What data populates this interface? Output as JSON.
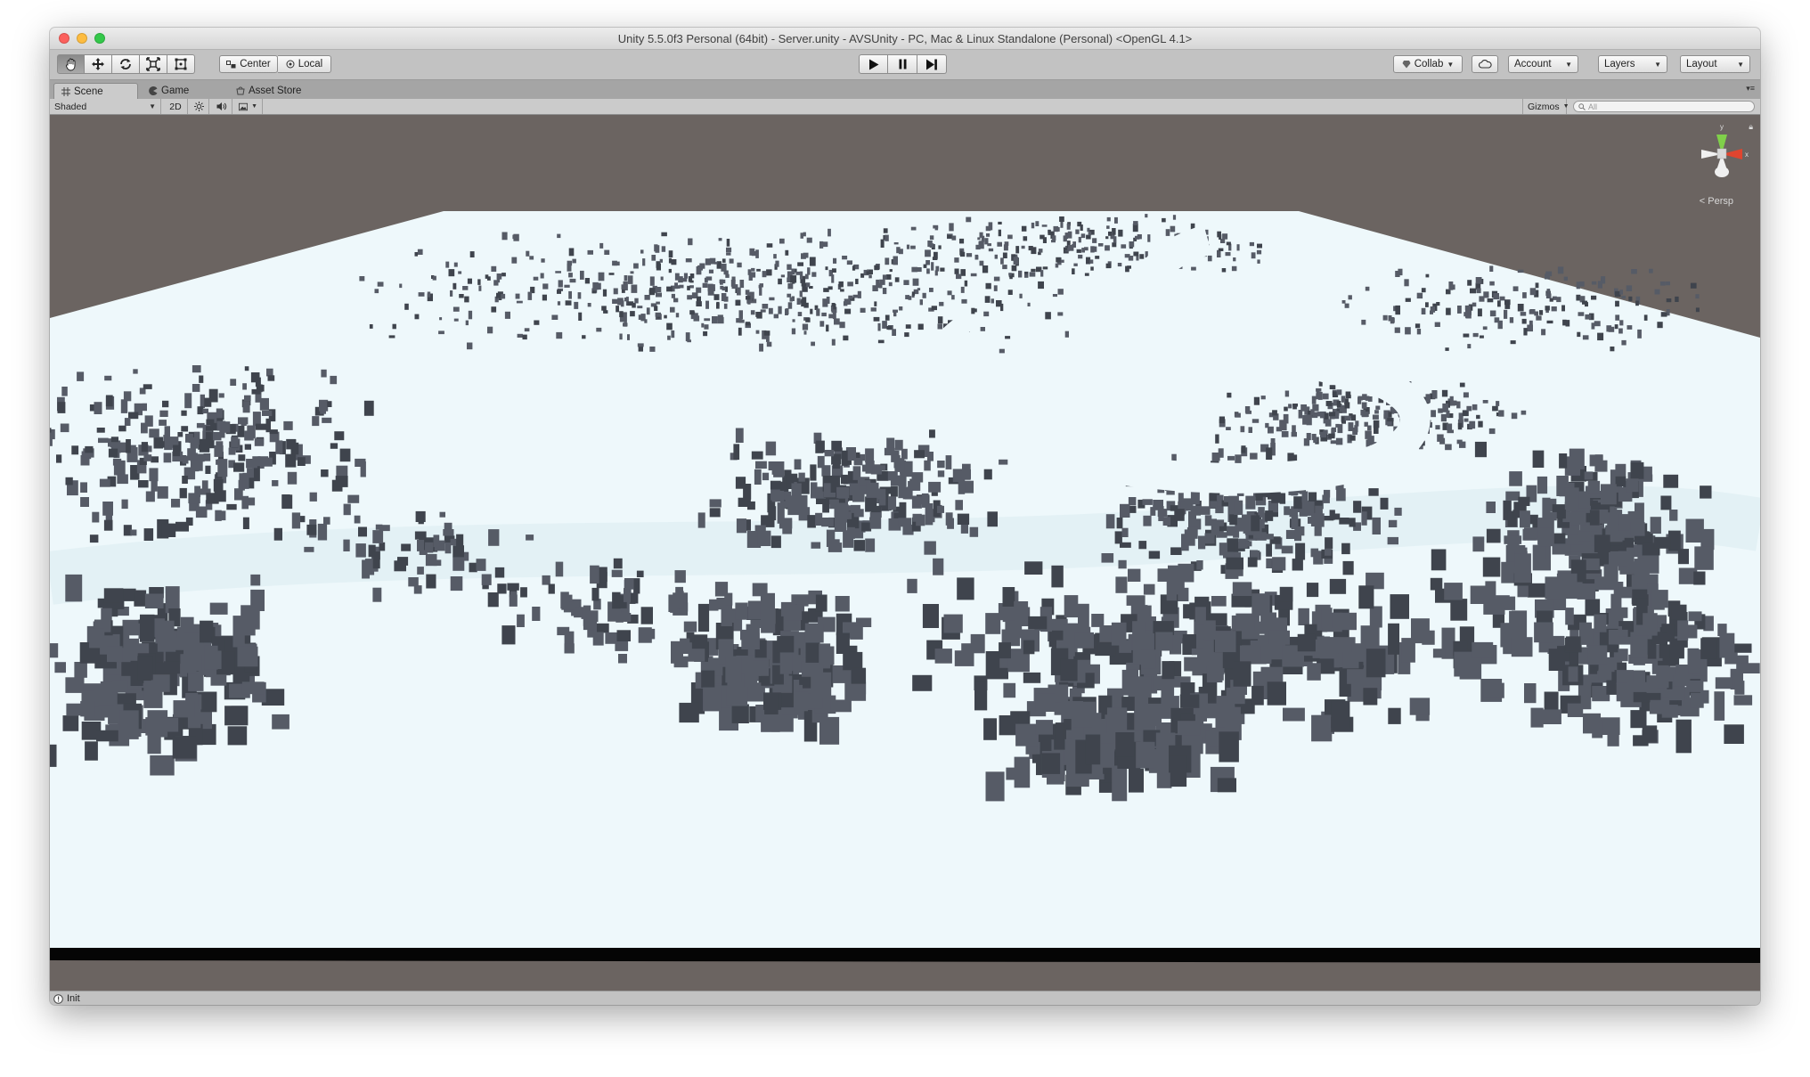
{
  "window": {
    "title": "Unity 5.5.0f3 Personal (64bit) - Server.unity - AVSUnity - PC, Mac & Linux Standalone (Personal) <OpenGL 4.1>"
  },
  "toolbar": {
    "tools": [
      "hand-icon",
      "move-icon",
      "rotate-icon",
      "scale-icon",
      "rect-icon"
    ],
    "pivot_label": "Center",
    "space_label": "Local",
    "collab_label": "Collab",
    "account_label": "Account",
    "layers_label": "Layers",
    "layout_label": "Layout"
  },
  "tabs": [
    {
      "label": "Scene",
      "icon": "grid-icon",
      "active": true
    },
    {
      "label": "Game",
      "icon": "pacman-icon",
      "active": false
    },
    {
      "label": "Asset Store",
      "icon": "shop-icon",
      "active": false
    }
  ],
  "scene_toolbar": {
    "draw_mode": "Shaded",
    "mode_2d": "2D",
    "gizmos_label": "Gizmos",
    "search_placeholder": "All"
  },
  "scene": {
    "projection_label": "Persp",
    "axis_x": "x",
    "axis_y": "y",
    "colors": {
      "background": "#6b6461",
      "terrain": "#eef8fb",
      "buildings": "#4d525c",
      "terrain_edge": "#050505"
    }
  },
  "status": {
    "message": "Init",
    "icon": "info-icon"
  }
}
